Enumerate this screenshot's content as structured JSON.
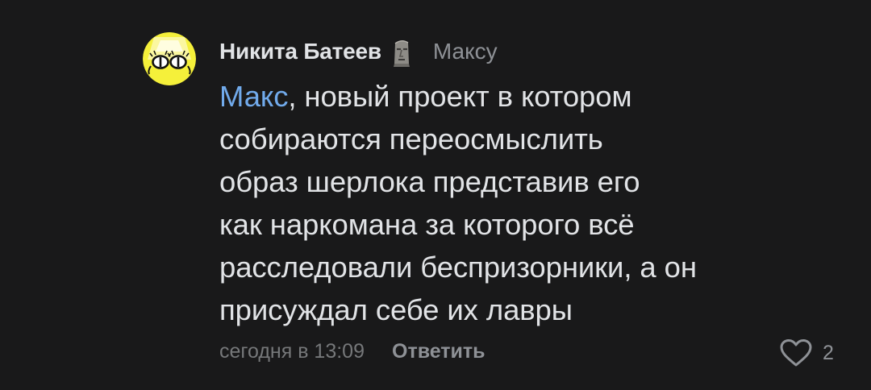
{
  "comment": {
    "avatar_icon": "cartoon-face-avatar-icon",
    "author_name": "Никита Батеев",
    "author_emoji_icon": "moai-emoji-icon",
    "reply_to": "Максу",
    "mention": "Макс",
    "text_lines": [
      ", новый проект в котором",
      "собираются переосмыслить",
      "образ шерлока представив его",
      "как наркомана за которого всё",
      "расследовали беспризорники, а он",
      "присуждал себе их лавры"
    ],
    "timestamp": "сегодня в 13:09",
    "reply_label": "Ответить",
    "like_icon": "heart-outline-icon",
    "like_count": "2"
  },
  "colors": {
    "background": "#19191a",
    "text_primary": "#e1e3e6",
    "text_secondary": "#8e9196",
    "link": "#71aaeb",
    "avatar_yellow": "#f5f03a"
  }
}
